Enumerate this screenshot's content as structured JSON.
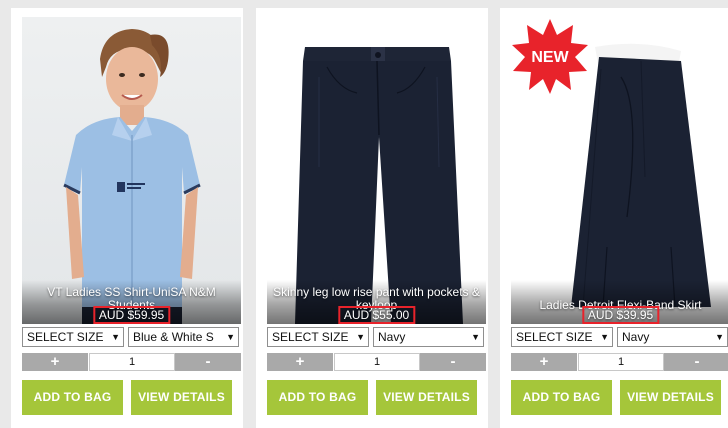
{
  "products": [
    {
      "title": "VT Ladies SS Shirt-UniSA N&M Students",
      "price": "AUD $59.95",
      "size_select": "SELECT SIZE",
      "colour_select": "Blue & White S",
      "qty_minus": "+",
      "qty_value": "1",
      "qty_plus": "-",
      "add_label": "ADD TO BAG",
      "view_label": "VIEW DETAILS"
    },
    {
      "title": "Skinny leg low rise pant with pockets & keyloop",
      "price": "AUD $55.00",
      "size_select": "SELECT SIZE",
      "colour_select": "Navy",
      "qty_minus": "+",
      "qty_value": "1",
      "qty_plus": "-",
      "add_label": "ADD TO BAG",
      "view_label": "VIEW DETAILS"
    },
    {
      "title": "Ladies Detroit Flexi-Band Skirt",
      "price": "AUD $39.95",
      "badge": "NEW",
      "size_select": "SELECT SIZE",
      "colour_select": "Navy",
      "qty_minus": "+",
      "qty_value": "1",
      "qty_plus": "-",
      "add_label": "ADD TO BAG",
      "view_label": "VIEW DETAILS"
    }
  ],
  "colors": {
    "accent_green": "#a5c63a",
    "price_highlight": "#e8232b",
    "qty_button": "#a9a9a9",
    "navy_garment": "#1b2233",
    "shirt_blue": "#9cbfe4"
  }
}
